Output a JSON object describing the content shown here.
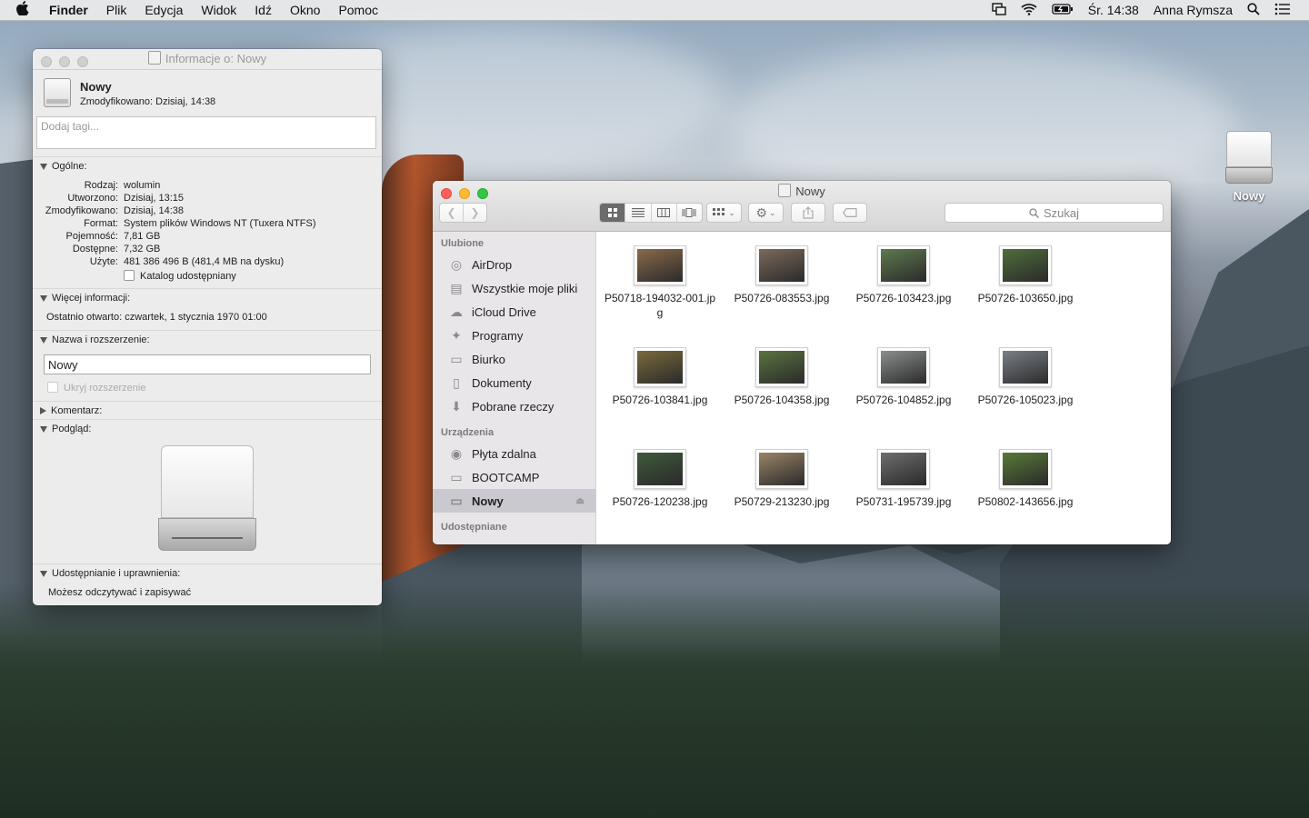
{
  "menubar": {
    "apple": "",
    "app_name": "Finder",
    "items": [
      "Plik",
      "Edycja",
      "Widok",
      "Idź",
      "Okno",
      "Pomoc"
    ],
    "clock": "Śr. 14:38",
    "user": "Anna Rymsza"
  },
  "info_window": {
    "title": "Informacje o: Nowy",
    "name": "Nowy",
    "modified": "Zmodyfikowano: Dzisiaj, 14:38",
    "tags_placeholder": "Dodaj tagi...",
    "general": {
      "header": "Ogólne:",
      "rows": [
        {
          "k": "Rodzaj:",
          "v": "wolumin"
        },
        {
          "k": "Utworzono:",
          "v": "Dzisiaj, 13:15"
        },
        {
          "k": "Zmodyfikowano:",
          "v": "Dzisiaj, 14:38"
        },
        {
          "k": "Format:",
          "v": "System plików Windows NT (Tuxera NTFS)"
        },
        {
          "k": "Pojemność:",
          "v": "7,81 GB"
        },
        {
          "k": "Dostępne:",
          "v": "7,32 GB"
        },
        {
          "k": "Użyte:",
          "v": "481 386 496 B (481,4 MB na dysku)"
        }
      ],
      "shared_checkbox": "Katalog udostępniany"
    },
    "more_info": {
      "header": "Więcej informacji:",
      "last_opened": "Ostatnio otwarto: czwartek, 1 stycznia 1970 01:00"
    },
    "name_ext": {
      "header": "Nazwa i rozszerzenie:",
      "value": "Nowy",
      "hide_ext": "Ukryj rozszerzenie"
    },
    "comments_header": "Komentarz:",
    "preview_header": "Podgląd:",
    "sharing": {
      "header": "Udostępnianie i uprawnienia:",
      "text": "Możesz odczytywać i zapisywać"
    }
  },
  "finder": {
    "title": "Nowy",
    "search_placeholder": "Szukaj",
    "sidebar": {
      "favorites_header": "Ulubione",
      "favorites": [
        {
          "label": "AirDrop",
          "icon": "airdrop-icon",
          "glyph": "◎"
        },
        {
          "label": "Wszystkie moje pliki",
          "icon": "all-files-icon",
          "glyph": "▤"
        },
        {
          "label": "iCloud Drive",
          "icon": "cloud-icon",
          "glyph": "☁"
        },
        {
          "label": "Programy",
          "icon": "applications-icon",
          "glyph": "✦"
        },
        {
          "label": "Biurko",
          "icon": "desktop-icon",
          "glyph": "▭"
        },
        {
          "label": "Dokumenty",
          "icon": "documents-icon",
          "glyph": "▯"
        },
        {
          "label": "Pobrane rzeczy",
          "icon": "downloads-icon",
          "glyph": "⬇"
        }
      ],
      "devices_header": "Urządzenia",
      "devices": [
        {
          "label": "Płyta zdalna",
          "icon": "remote-disc-icon",
          "glyph": "◉"
        },
        {
          "label": "BOOTCAMP",
          "icon": "drive-icon",
          "glyph": "▭"
        },
        {
          "label": "Nowy",
          "icon": "drive-icon",
          "glyph": "▭"
        }
      ],
      "shared_header": "Udostępniane"
    },
    "files": [
      {
        "name": "P50718-194032-001.jpg",
        "color": "#8a6a4a"
      },
      {
        "name": "P50726-083553.jpg",
        "color": "#7c6a5c"
      },
      {
        "name": "P50726-103423.jpg",
        "color": "#5f7a4e"
      },
      {
        "name": "P50726-103650.jpg",
        "color": "#4f6e3a"
      },
      {
        "name": "P50726-103841.jpg",
        "color": "#7a6b3c"
      },
      {
        "name": "P50726-104358.jpg",
        "color": "#5b7340"
      },
      {
        "name": "P50726-104852.jpg",
        "color": "#8b8f8c"
      },
      {
        "name": "P50726-105023.jpg",
        "color": "#7a8088"
      },
      {
        "name": "P50726-120238.jpg",
        "color": "#3f5a3c"
      },
      {
        "name": "P50729-213230.jpg",
        "color": "#9a8468"
      },
      {
        "name": "P50731-195739.jpg",
        "color": "#6e6e6e"
      },
      {
        "name": "P50802-143656.jpg",
        "color": "#5a7a36"
      }
    ]
  },
  "desktop": {
    "icon_label": "Nowy"
  }
}
